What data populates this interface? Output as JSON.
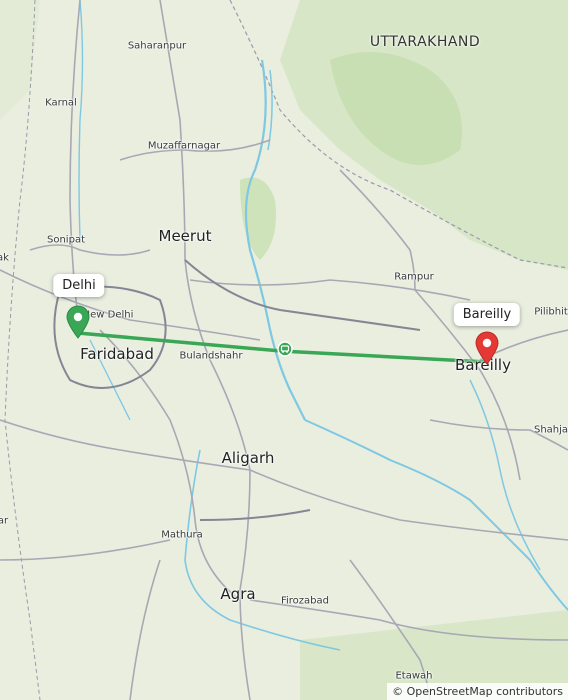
{
  "map": {
    "region_label": "UTTARAKHAND",
    "cities": {
      "saharanpur": "Saharanpur",
      "karnal": "Karnal",
      "muzaffarnagar": "Muzaffarnagar",
      "sonipat": "Sonipat",
      "meerut": "Meerut",
      "new_delhi": "New Delhi",
      "faridabad": "Faridabad",
      "bulandshahr": "Bulandshahr",
      "rampur": "Rampur",
      "pilibhit": "Pilibhit",
      "bareilly": "Bareilly",
      "aligarh": "Aligarh",
      "mathura": "Mathura",
      "agra": "Agra",
      "firozabad": "Firozabad",
      "shahjahanpur": "Shahja",
      "etawah": "Etawah",
      "left_edge_1": "ak",
      "left_edge_2": "ar"
    },
    "route": {
      "origin_label": "Delhi",
      "destination_label": "Bareilly",
      "route_color": "#3aa757",
      "origin_color": "#3aa757",
      "destination_color": "#e53935"
    },
    "attribution": "© OpenStreetMap contributors"
  }
}
